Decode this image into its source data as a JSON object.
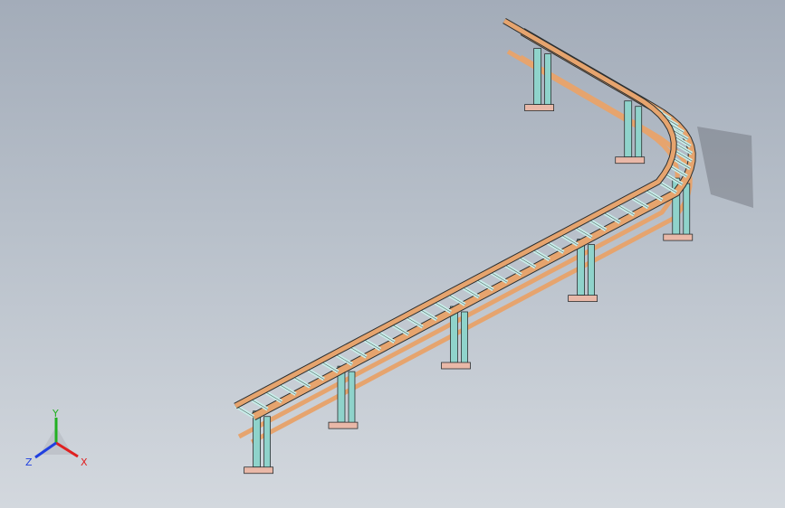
{
  "viewport": {
    "background_top": "#a3acb9",
    "background_bottom": "#d3d8de"
  },
  "model": {
    "frame_color": "#e6a46e",
    "roller_color": "#c8efea",
    "support_color": "#8fd3cb",
    "foot_color": "#e9b8a8",
    "outline_color": "#2b2f30"
  },
  "triad": {
    "x_label": "X",
    "y_label": "Y",
    "z_label": "Z",
    "x_color": "#e02020",
    "y_color": "#22b022",
    "z_color": "#2040e0"
  }
}
